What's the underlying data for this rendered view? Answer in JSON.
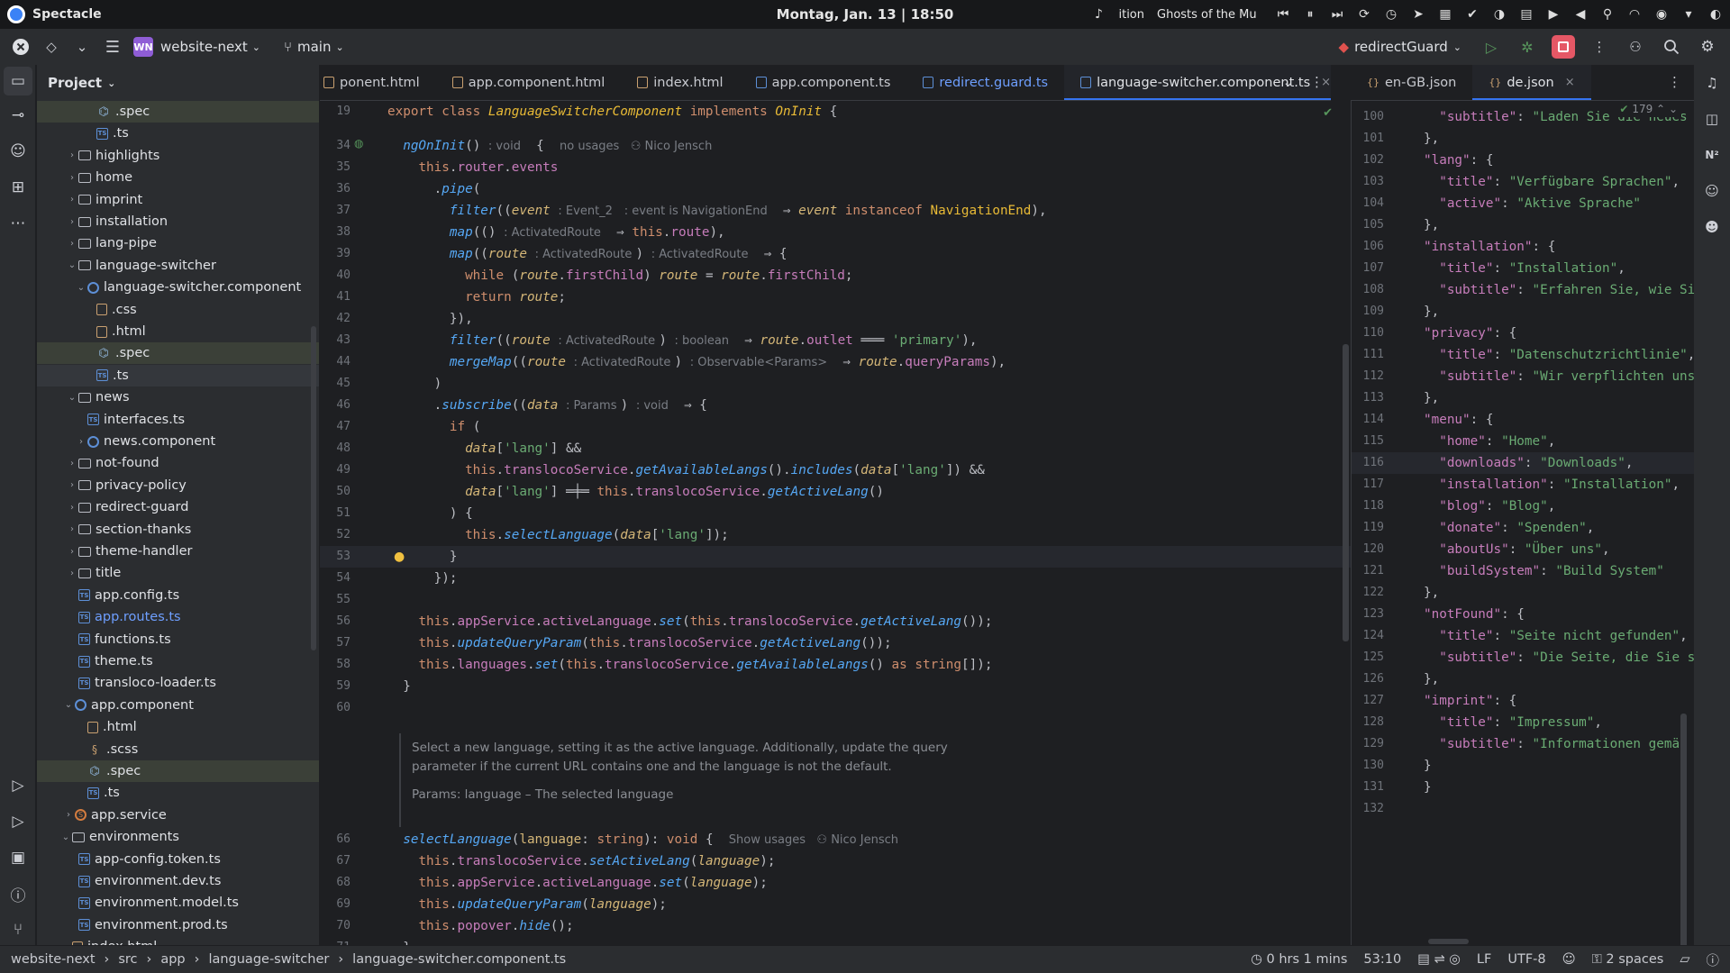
{
  "system_bar": {
    "app_name": "Spectacle",
    "clock": "Montag, Jan. 13 | 18:50",
    "media_left": "ition",
    "media_title": "Ghosts of the Mu"
  },
  "title_bar": {
    "project_badge": "WN",
    "project_name": "website-next",
    "branch": "main",
    "run_config": "redirectGuard"
  },
  "project_panel": {
    "title": "Project",
    "tree": [
      {
        "indent": 3,
        "icon": "spec",
        "label": ".spec",
        "sel": true
      },
      {
        "indent": 3,
        "icon": "ts",
        "label": ".ts"
      },
      {
        "indent": 1,
        "icon": "folder",
        "label": "highlights",
        "chev": "›"
      },
      {
        "indent": 1,
        "icon": "folder",
        "label": "home",
        "chev": "›"
      },
      {
        "indent": 1,
        "icon": "folder",
        "label": "imprint",
        "chev": "›"
      },
      {
        "indent": 1,
        "icon": "folder",
        "label": "installation",
        "chev": "›"
      },
      {
        "indent": 1,
        "icon": "folder",
        "label": "lang-pipe",
        "chev": "›"
      },
      {
        "indent": 1,
        "icon": "folder",
        "label": "language-switcher",
        "chev": "⌄"
      },
      {
        "indent": 2,
        "icon": "comp",
        "label": "language-switcher.component",
        "chev": "⌄"
      },
      {
        "indent": 3,
        "icon": "css",
        "label": ".css"
      },
      {
        "indent": 3,
        "icon": "html",
        "label": ".html"
      },
      {
        "indent": 3,
        "icon": "spec",
        "label": ".spec",
        "sel": true
      },
      {
        "indent": 3,
        "icon": "ts",
        "label": ".ts",
        "sel2": true
      },
      {
        "indent": 1,
        "icon": "folder",
        "label": "news",
        "chev": "⌄"
      },
      {
        "indent": 2,
        "icon": "ts",
        "label": "interfaces.ts"
      },
      {
        "indent": 2,
        "icon": "comp",
        "label": "news.component",
        "chev": "›"
      },
      {
        "indent": 1,
        "icon": "folder",
        "label": "not-found",
        "chev": "›"
      },
      {
        "indent": 1,
        "icon": "folder",
        "label": "privacy-policy",
        "chev": "›"
      },
      {
        "indent": 1,
        "icon": "folder",
        "label": "redirect-guard",
        "chev": "›"
      },
      {
        "indent": 1,
        "icon": "folder",
        "label": "section-thanks",
        "chev": "›"
      },
      {
        "indent": 1,
        "icon": "folder",
        "label": "theme-handler",
        "chev": "›"
      },
      {
        "indent": 1,
        "icon": "folder",
        "label": "title",
        "chev": "›"
      },
      {
        "indent": 1,
        "icon": "ts",
        "label": "app.config.ts"
      },
      {
        "indent": 1,
        "icon": "ts",
        "label": "app.routes.ts",
        "blue": true
      },
      {
        "indent": 1,
        "icon": "ts",
        "label": "functions.ts"
      },
      {
        "indent": 1,
        "icon": "ts",
        "label": "theme.ts"
      },
      {
        "indent": 1,
        "icon": "ts",
        "label": "transloco-loader.ts"
      },
      {
        "indent": 0.6,
        "icon": "comp",
        "label": "app.component",
        "chev": "⌄"
      },
      {
        "indent": 2,
        "icon": "html",
        "label": ".html"
      },
      {
        "indent": 2,
        "icon": "scss",
        "label": ".scss"
      },
      {
        "indent": 2,
        "icon": "spec",
        "label": ".spec",
        "sel": true
      },
      {
        "indent": 2,
        "icon": "ts",
        "label": ".ts"
      },
      {
        "indent": 0.6,
        "icon": "svc",
        "label": "app.service",
        "chev": "›"
      },
      {
        "indent": 0.3,
        "icon": "folder",
        "label": "environments",
        "chev": "⌄"
      },
      {
        "indent": 1,
        "icon": "ts",
        "label": "app-config.token.ts"
      },
      {
        "indent": 1,
        "icon": "ts",
        "label": "environment.dev.ts"
      },
      {
        "indent": 1,
        "icon": "ts",
        "label": "environment.model.ts"
      },
      {
        "indent": 1,
        "icon": "ts",
        "label": "environment.prod.ts"
      },
      {
        "indent": 0.3,
        "icon": "html",
        "label": "index.html"
      }
    ]
  },
  "tabs": [
    {
      "label": "ponent.html",
      "icon": "h"
    },
    {
      "label": "app.component.html",
      "icon": "h"
    },
    {
      "label": "index.html",
      "icon": "h"
    },
    {
      "label": "app.component.ts",
      "icon": "t"
    },
    {
      "label": "redirect.guard.ts",
      "icon": "t",
      "blue": true
    },
    {
      "label": "language-switcher.component.ts",
      "icon": "t",
      "active": true,
      "close": "×"
    }
  ],
  "right_tabs": [
    {
      "label": "en-GB.json"
    },
    {
      "label": "de.json",
      "active": true,
      "close": "×"
    }
  ],
  "editor_lines": [
    {
      "n": "19",
      "html": "<span class='kw'>export class</span> <span class='cls it'>LanguageSwitcherComponent</span> <span class='kw'>implements</span> <span class='cls it'>OnInit</span> {"
    },
    {
      "n": "34",
      "html": "  <span class='fn it'>ngOnInit</span>() <span class='hint'>: void</span>  {  <span class='hint'>no usages   ⚇ Nico Jensch</span>"
    },
    {
      "n": "35",
      "html": "    <span class='kw'>this</span>.<span class='prop'>router</span>.<span class='prop'>events</span>"
    },
    {
      "n": "36",
      "html": "      .<span class='fn it'>pipe</span>("
    },
    {
      "n": "37",
      "html": "        <span class='fn it'>filter</span>((<span class='par it'>event</span> <span class='hint'>: Event_2 </span> <span class='hint'>: event is NavigationEnd</span>  ⇒ <span class='par it'>event</span> <span class='kw'>instanceof</span> <span class='cls'>NavigationEnd</span>),"
    },
    {
      "n": "38",
      "html": "        <span class='fn it'>map</span>(() <span class='hint'>: ActivatedRoute</span>  ⇒ <span class='kw'>this</span>.<span class='prop'>route</span>),"
    },
    {
      "n": "39",
      "html": "        <span class='fn it'>map</span>((<span class='par it'>route</span> <span class='hint'>: ActivatedRoute </span>) <span class='hint'>: ActivatedRoute</span>  ⇒ {"
    },
    {
      "n": "40",
      "html": "          <span class='kw'>while</span> (<span class='par it'>route</span>.<span class='prop'>firstChild</span>) <span class='par it'>route</span> = <span class='par it'>route</span>.<span class='prop'>firstChild</span>;"
    },
    {
      "n": "41",
      "html": "          <span class='kw'>return</span> <span class='par it'>route</span>;"
    },
    {
      "n": "42",
      "html": "        }),"
    },
    {
      "n": "43",
      "html": "        <span class='fn it'>filter</span>((<span class='par it'>route</span> <span class='hint'>: ActivatedRoute </span>) <span class='hint'>: boolean</span>  ⇒ <span class='par it'>route</span>.<span class='prop'>outlet</span> ═══ <span class='str'>'primary'</span>),"
    },
    {
      "n": "44",
      "html": "        <span class='fn it'>mergeMap</span>((<span class='par it'>route</span> <span class='hint'>: ActivatedRoute </span>) <span class='hint'>: Observable&lt;Params&gt;</span>  ⇒ <span class='par it'>route</span>.<span class='prop'>queryParams</span>),"
    },
    {
      "n": "45",
      "html": "      )"
    },
    {
      "n": "46",
      "html": "      .<span class='fn it'>subscribe</span>((<span class='par it'>data</span> <span class='hint'>: Params </span>) <span class='hint'>: void</span>  ⇒ {"
    },
    {
      "n": "47",
      "html": "        <span class='kw'>if</span> ("
    },
    {
      "n": "48",
      "html": "          <span class='par it'>data</span>[<span class='str'>'lang'</span>] &amp;&amp;"
    },
    {
      "n": "49",
      "html": "          <span class='kw'>this</span>.<span class='prop'>translocoService</span>.<span class='fn it'>getAvailableLangs</span>().<span class='fn it'>includes</span>(<span class='par it'>data</span>[<span class='str'>'lang'</span>]) &amp;&amp;"
    },
    {
      "n": "50",
      "html": "          <span class='par it'>data</span>[<span class='str'>'lang'</span>] ═╪═ <span class='kw'>this</span>.<span class='prop'>translocoService</span>.<span class='fn it'>getActiveLang</span>()"
    },
    {
      "n": "51",
      "html": "        ) {"
    },
    {
      "n": "52",
      "html": "          <span class='kw'>this</span>.<span class='fn it'>selectLanguage</span>(<span class='par it'>data</span>[<span class='str'>'lang'</span>]);"
    },
    {
      "n": "53",
      "html": "        }",
      "cur": true
    },
    {
      "n": "54",
      "html": "      });"
    },
    {
      "n": "55",
      "html": ""
    },
    {
      "n": "56",
      "html": "    <span class='kw'>this</span>.<span class='prop'>appService</span>.<span class='prop'>activeLanguage</span>.<span class='fn it'>set</span>(<span class='kw'>this</span>.<span class='prop'>translocoService</span>.<span class='fn it'>getActiveLang</span>());"
    },
    {
      "n": "57",
      "html": "    <span class='kw'>this</span>.<span class='fn it'>updateQueryParam</span>(<span class='kw'>this</span>.<span class='prop'>translocoService</span>.<span class='fn it'>getActiveLang</span>());"
    },
    {
      "n": "58",
      "html": "    <span class='kw'>this</span>.<span class='prop'>languages</span>.<span class='fn it'>set</span>(<span class='kw'>this</span>.<span class='prop'>translocoService</span>.<span class='fn it'>getAvailableLangs</span>() <span class='kw'>as</span> <span class='kw'>string</span>[]);"
    },
    {
      "n": "59",
      "html": "  }"
    },
    {
      "n": "60",
      "html": ""
    }
  ],
  "doc_comment": {
    "text": "Select a new language, setting it as the active language. Additionally, update the query parameter if the current URL contains one and the language is not the default.",
    "params": "Params: language – The selected language"
  },
  "editor_lines2": [
    {
      "n": "66",
      "html": "  <span class='fn it'>selectLanguage</span>(<span class='par'>language</span>: <span class='kw'>string</span>): <span class='kw'>void</span> {  <span class='hint'>Show usages   ⚇ Nico Jensch</span>"
    },
    {
      "n": "67",
      "html": "    <span class='kw'>this</span>.<span class='prop'>translocoService</span>.<span class='fn it'>setActiveLang</span>(<span class='par it'>language</span>);"
    },
    {
      "n": "68",
      "html": "    <span class='kw'>this</span>.<span class='prop'>appService</span>.<span class='prop'>activeLanguage</span>.<span class='fn it'>set</span>(<span class='par it'>language</span>);"
    },
    {
      "n": "69",
      "html": "    <span class='kw'>this</span>.<span class='fn it'>updateQueryParam</span>(<span class='par it'>language</span>);"
    },
    {
      "n": "70",
      "html": "    <span class='kw'>this</span>.<span class='prop'>popover</span>.<span class='fn it'>hide</span>();"
    },
    {
      "n": "71",
      "html": "  }"
    }
  ],
  "json_lines": [
    {
      "n": "100",
      "html": "  <span class='jk'>\"subtitle\"</span>: <span class='jv'>\"Laden Sie die neues</span>"
    },
    {
      "n": "101",
      "html": "},"
    },
    {
      "n": "102",
      "html": "<span class='jk'>\"lang\"</span>: {"
    },
    {
      "n": "103",
      "html": "  <span class='jk'>\"title\"</span>: <span class='jv'>\"Verfügbare Sprachen\"</span>,"
    },
    {
      "n": "104",
      "html": "  <span class='jk'>\"active\"</span>: <span class='jv'>\"Aktive Sprache\"</span>"
    },
    {
      "n": "105",
      "html": "},"
    },
    {
      "n": "106",
      "html": "<span class='jk'>\"installation\"</span>: {"
    },
    {
      "n": "107",
      "html": "  <span class='jk'>\"title\"</span>: <span class='jv'>\"Installation\"</span>,"
    },
    {
      "n": "108",
      "html": "  <span class='jk'>\"subtitle\"</span>: <span class='jv'>\"Erfahren Sie, wie Si</span>"
    },
    {
      "n": "109",
      "html": "},"
    },
    {
      "n": "110",
      "html": "<span class='jk'>\"privacy\"</span>: {"
    },
    {
      "n": "111",
      "html": "  <span class='jk'>\"title\"</span>: <span class='jv'>\"Datenschutzrichtlinie\"</span>,"
    },
    {
      "n": "112",
      "html": "  <span class='jk'>\"subtitle\"</span>: <span class='jv'>\"Wir verpflichten uns</span>"
    },
    {
      "n": "113",
      "html": "},"
    },
    {
      "n": "114",
      "html": "<span class='jk'>\"menu\"</span>: {"
    },
    {
      "n": "115",
      "html": "  <span class='jk'>\"home\"</span>: <span class='jv'>\"Home\"</span>,"
    },
    {
      "n": "116",
      "html": "  <span class='jk'>\"downloads\"</span>: <span class='jv'>\"Downloads\"</span>,",
      "cur": true
    },
    {
      "n": "117",
      "html": "  <span class='jk'>\"installation\"</span>: <span class='jv'>\"Installation\"</span>,"
    },
    {
      "n": "118",
      "html": "  <span class='jk'>\"blog\"</span>: <span class='jv'>\"Blog\"</span>,"
    },
    {
      "n": "119",
      "html": "  <span class='jk'>\"donate\"</span>: <span class='jv'>\"Spenden\"</span>,"
    },
    {
      "n": "120",
      "html": "  <span class='jk'>\"aboutUs\"</span>: <span class='jv'>\"Über uns\"</span>,"
    },
    {
      "n": "121",
      "html": "  <span class='jk'>\"buildSystem\"</span>: <span class='jv'>\"Build System\"</span>"
    },
    {
      "n": "122",
      "html": "},"
    },
    {
      "n": "123",
      "html": "<span class='jk'>\"notFound\"</span>: {"
    },
    {
      "n": "124",
      "html": "  <span class='jk'>\"title\"</span>: <span class='jv'>\"Seite nicht gefunden\"</span>,"
    },
    {
      "n": "125",
      "html": "  <span class='jk'>\"subtitle\"</span>: <span class='jv'>\"Die Seite, die Sie s</span>"
    },
    {
      "n": "126",
      "html": "},"
    },
    {
      "n": "127",
      "html": "<span class='jk'>\"imprint\"</span>: {"
    },
    {
      "n": "128",
      "html": "  <span class='jk'>\"title\"</span>: <span class='jv'>\"Impressum\"</span>,"
    },
    {
      "n": "129",
      "html": "  <span class='jk'>\"subtitle\"</span>: <span class='jv'>\"Informationen gemäß</span>"
    },
    {
      "n": "130",
      "html": "}"
    },
    {
      "n": "131",
      "html": "}"
    },
    {
      "n": "132",
      "html": ""
    }
  ],
  "json_info": {
    "check_count": "179"
  },
  "status_bar": {
    "crumbs": [
      "website-next",
      "src",
      "app",
      "language-switcher",
      "language-switcher.component.ts"
    ],
    "time_tracked": "0 hrs 1 mins",
    "position": "53:10",
    "line_sep": "LF",
    "encoding": "UTF-8",
    "indent": "2 spaces"
  }
}
